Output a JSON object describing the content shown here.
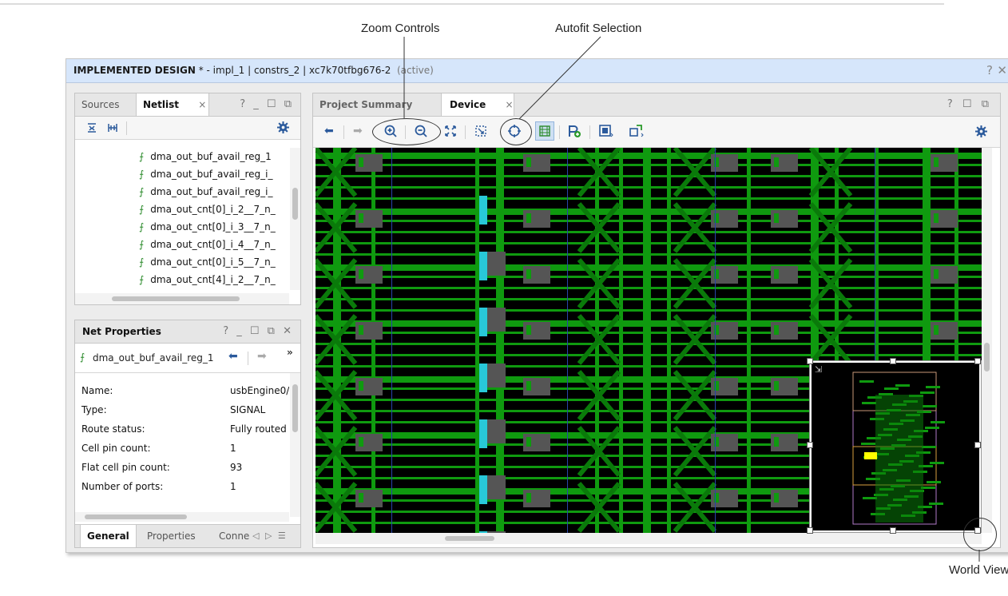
{
  "annotations": {
    "zoom_controls": "Zoom Controls",
    "autofit_selection": "Autofit Selection",
    "world_view": "World View"
  },
  "window": {
    "title_bold": "IMPLEMENTED DESIGN",
    "title_rest": " * - impl_1 | constrs_2 | xc7k70tfbg676-2",
    "title_status": "(active)",
    "help_icon": "?",
    "close_icon": "✕"
  },
  "left_top": {
    "tabs": [
      "Sources",
      "Netlist"
    ],
    "tab_close": "×",
    "controls": "? _ ☐ ⧉",
    "toolbar": {
      "collapse": "collapse-all-icon",
      "expand": "expand-all-icon",
      "settings": "gear-icon"
    },
    "rows": [
      "dma_out_buf_avail_reg_1",
      "dma_out_buf_avail_reg_i_",
      "dma_out_buf_avail_reg_i_",
      "dma_out_cnt[0]_i_2__7_n_",
      "dma_out_cnt[0]_i_3__7_n_",
      "dma_out_cnt[0]_i_4__7_n_",
      "dma_out_cnt[0]_i_5__7_n_",
      "dma_out_cnt[4]_i_2__7_n_"
    ]
  },
  "net_props": {
    "title": "Net Properties",
    "controls": "? _ ☐ ⧉ ✕",
    "selected_net": "dma_out_buf_avail_reg_1",
    "more": "»",
    "rows": [
      {
        "label": "Name:",
        "value": "usbEngine0/"
      },
      {
        "label": "Type:",
        "value": "SIGNAL"
      },
      {
        "label": "Route status:",
        "value": "Fully routed"
      },
      {
        "label": "Cell pin count:",
        "value": "1"
      },
      {
        "label": "Flat cell pin count:",
        "value": "93"
      },
      {
        "label": "Number of ports:",
        "value": "1"
      }
    ],
    "bottom_tabs": [
      "General",
      "Properties",
      "Conne"
    ]
  },
  "device": {
    "tabs": [
      "Project Summary",
      "Device"
    ],
    "tab_close": "×",
    "controls": "? ☐ ⧉",
    "toolbar_icons": [
      "back-arrow-icon",
      "forward-arrow-icon",
      "zoom-in-icon",
      "zoom-out-icon",
      "zoom-fit-icon",
      "zoom-to-selected-icon",
      "autofit-selection-icon",
      "routing-resources-icon",
      "add-pblock-icon",
      "world-view-toggle-icon",
      "auto-fit-icon",
      "gear-icon"
    ]
  },
  "colors": {
    "route_green": "#0f9a0f",
    "route_dark": "#0a7a0a",
    "clb_gray": "#555555",
    "clb_cyan": "#28c8d8",
    "selection_yellow": "#ffff00",
    "title_blue": "#d6e6fb"
  }
}
